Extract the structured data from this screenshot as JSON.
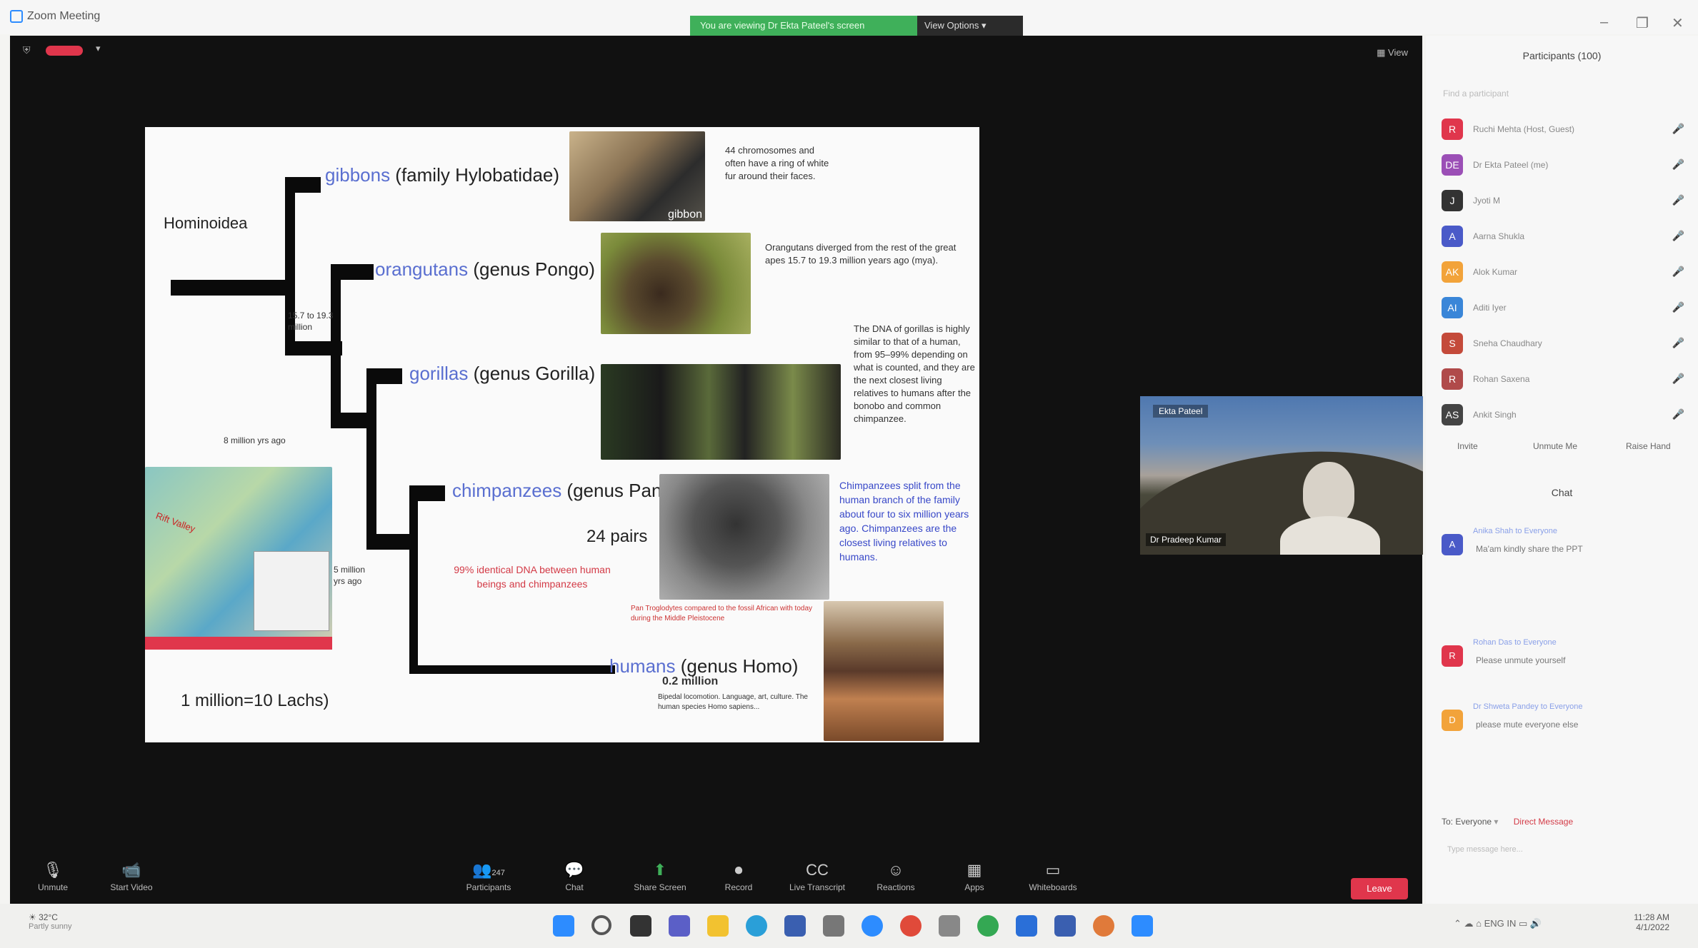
{
  "window": {
    "title": "Zoom Meeting",
    "share_banner": "You are viewing Dr Ekta Pateel's screen",
    "view_options": "View Options"
  },
  "meeting": {
    "view_label": "View",
    "slide": {
      "superfamily": "Hominoidea",
      "taxa": [
        {
          "name": "gibbons",
          "detail": " (family Hylobatidae)"
        },
        {
          "name": "orangutans",
          "detail": " (genus Pongo)"
        },
        {
          "name": "gorillas",
          "detail": " (genus Gorilla)"
        },
        {
          "name": "chimpanzees",
          "detail": " (genus Pan)"
        },
        {
          "name": "humans",
          "detail": " (genus Homo)"
        }
      ],
      "gibbon_note": "44 chromosomes and often have a ring of white fur around their faces.",
      "orangutan_note": "Orangutans diverged from the rest of the great apes 15.7 to 19.3 million years ago (mya).",
      "gorilla_note": "The DNA of gorillas is highly similar to that of a human, from 95–99% depending on what is counted, and they are the next closest living relatives to humans after the bonobo and common chimpanzee.",
      "chimp_note": "Chimpanzees split from the human branch of the family about four to six million years ago. Chimpanzees are the closest living relatives to humans.",
      "divergence_orang": "15.7 to 19.3 million",
      "divergence_gorilla": "8 million yrs ago",
      "divergence_chimp": "5 million yrs ago",
      "pairs": "24 pairs",
      "identical_dna": "99% identical DNA between human beings and chimpanzees",
      "gibbon_photo_label": "gibbon",
      "chimp_caption": "Pan Troglodytes compared to the fossil African with today during the Middle Pleistocene",
      "human_age": "0.2 million",
      "human_notes": "Bipedal locomotion. Language, art, culture. The human species Homo sapiens...",
      "scale_note": "1 million=10 Lachs)",
      "map_label": "Rift Valley"
    },
    "speaker": {
      "tag": "Ekta Pateel",
      "name": "Dr Pradeep Kumar"
    },
    "toolbar": [
      {
        "icon": "mic-icon",
        "glyph": "🎙",
        "label": "Unmute"
      },
      {
        "icon": "video-icon",
        "glyph": "📹",
        "label": "Start Video"
      },
      {
        "icon": "participants-icon",
        "glyph": "👥",
        "label": "Participants"
      },
      {
        "icon": "chat-icon",
        "glyph": "💬",
        "label": "Chat"
      },
      {
        "icon": "share-screen-icon",
        "glyph": "⬆",
        "label": "Share Screen"
      },
      {
        "icon": "record-icon",
        "glyph": "⏺",
        "label": "Record"
      },
      {
        "icon": "transcript-icon",
        "glyph": "CC",
        "label": "Live Transcript"
      },
      {
        "icon": "reactions-icon",
        "glyph": "☺",
        "label": "Reactions"
      },
      {
        "icon": "apps-icon",
        "glyph": "▦",
        "label": "Apps"
      },
      {
        "icon": "whiteboard-icon",
        "glyph": "▭",
        "label": "Whiteboards"
      }
    ],
    "participant_count": "247",
    "end_label": "Leave"
  },
  "panel": {
    "title": "Participants (100)",
    "search_placeholder": "Find a participant",
    "participants": [
      {
        "initials": "R",
        "color": "#e0364c",
        "name": "Ruchi Mehta (Host, Guest)",
        "icon": "🎤"
      },
      {
        "initials": "DE",
        "color": "#9b4fb6",
        "name": "Dr Ekta Pateel (me)",
        "icon": "🎤"
      },
      {
        "initials": "J",
        "color": "#333333",
        "name": "Jyoti M",
        "icon": "🎤"
      },
      {
        "initials": "A",
        "color": "#4a5ac8",
        "name": "Aarna Shukla",
        "icon": "🎤"
      },
      {
        "initials": "AK",
        "color": "#f2a33a",
        "name": "Alok Kumar",
        "icon": "🎤"
      },
      {
        "initials": "AI",
        "color": "#3a86d8",
        "name": "Aditi Iyer",
        "icon": "🎤"
      },
      {
        "initials": "S",
        "color": "#c44a3a",
        "name": "Sneha Chaudhary",
        "icon": "🎤"
      },
      {
        "initials": "R",
        "color": "#b04a4a",
        "name": "Rohan Saxena",
        "icon": "🎤"
      },
      {
        "initials": "AS",
        "color": "#444444",
        "name": "Ankit Singh",
        "icon": "🎤"
      }
    ],
    "buttons": [
      "Invite",
      "Unmute Me",
      "Raise Hand"
    ],
    "chat_title": "Chat",
    "messages": [
      {
        "initials": "A",
        "color": "#4a5ac8",
        "header": "Anika Shah  to Everyone",
        "text": "Ma'am kindly share the PPT"
      },
      {
        "initials": "R",
        "color": "#e0364c",
        "header": "Rohan Das  to Everyone",
        "text": "Please unmute yourself"
      },
      {
        "initials": "D",
        "color": "#f2a33a",
        "header": "Dr Shweta Pandey  to Everyone",
        "text": "please mute everyone else"
      }
    ],
    "send_to": "To: Everyone",
    "direct_message": "Direct Message",
    "type_hint": "Type message here..."
  },
  "taskbar": {
    "weather": "32°C",
    "weather_desc": "Partly sunny",
    "lang": "ENG IN",
    "time": "11:28 AM",
    "date": "4/1/2022",
    "apps": [
      {
        "icon": "start-icon",
        "color": "#2d8cff"
      },
      {
        "icon": "search-icon",
        "color": "#555555"
      },
      {
        "icon": "task-view-icon",
        "color": "#333333"
      },
      {
        "icon": "chat-app-icon",
        "color": "#5b5fc7"
      },
      {
        "icon": "explorer-icon",
        "color": "#f2c230"
      },
      {
        "icon": "edge-icon",
        "color": "#2a9fd8"
      },
      {
        "icon": "store-icon",
        "color": "#3a5fb0"
      },
      {
        "icon": "settings-icon",
        "color": "#777777"
      },
      {
        "icon": "zoom-icon",
        "color": "#2d8cff"
      },
      {
        "icon": "chrome-icon",
        "color": "#e04a3a"
      },
      {
        "icon": "tools-icon",
        "color": "#888888"
      },
      {
        "icon": "chrome2-icon",
        "color": "#34a853"
      },
      {
        "icon": "mail-icon",
        "color": "#2a6fd8"
      },
      {
        "icon": "calc-icon",
        "color": "#3a5fb0"
      },
      {
        "icon": "photos-icon",
        "color": "#e07a3a"
      },
      {
        "icon": "zoom2-icon",
        "color": "#2d8cff"
      }
    ]
  }
}
